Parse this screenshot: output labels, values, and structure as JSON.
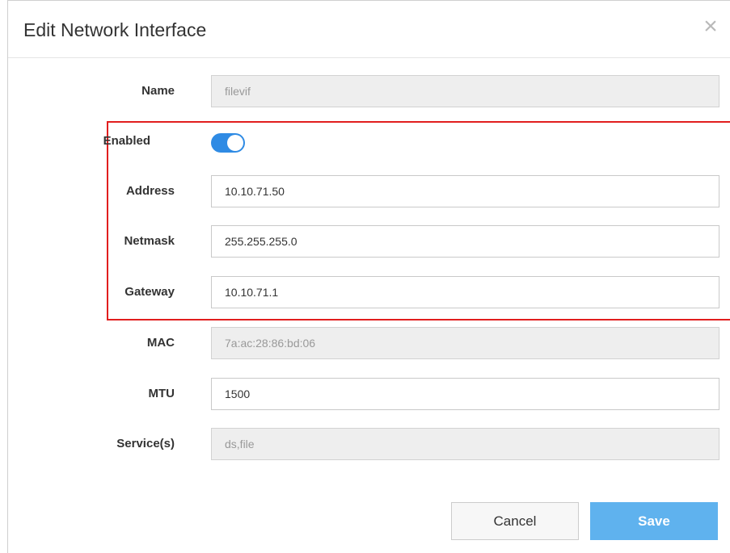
{
  "dialog": {
    "title": "Edit Network Interface",
    "close_glyph": "×"
  },
  "form": {
    "name": {
      "label": "Name",
      "value": "filevif",
      "readonly": true
    },
    "enabled": {
      "label": "Enabled",
      "value": true
    },
    "address": {
      "label": "Address",
      "value": "10.10.71.50"
    },
    "netmask": {
      "label": "Netmask",
      "value": "255.255.255.0"
    },
    "gateway": {
      "label": "Gateway",
      "value": "10.10.71.1"
    },
    "mac": {
      "label": "MAC",
      "value": "7a:ac:28:86:bd:06",
      "readonly": true
    },
    "mtu": {
      "label": "MTU",
      "value": "1500"
    },
    "services": {
      "label": "Service(s)",
      "value": "ds,file",
      "readonly": true
    }
  },
  "buttons": {
    "cancel": "Cancel",
    "save": "Save"
  },
  "colors": {
    "toggle_on": "#2f8be4",
    "highlight_box": "#e11e1e",
    "save_button": "#5fb2ee"
  }
}
